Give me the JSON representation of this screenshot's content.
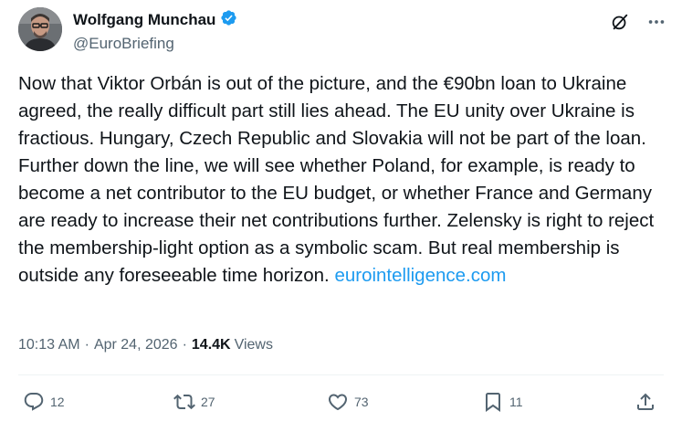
{
  "author": {
    "display_name": "Wolfgang Munchau",
    "handle": "@EuroBriefing",
    "verified": true,
    "verified_color": "#1d9bf0"
  },
  "top_icons": [
    "grok-icon",
    "more-icon"
  ],
  "tweet": {
    "text": "Now that Viktor Orbán is out of the picture, and the €90bn loan to Ukraine agreed, the really difficult part still lies ahead. The EU unity over Ukraine is fractious. Hungary, Czech Republic and Slovakia will not be part of the loan. Further down the line, we will see whether Poland, for example, is ready to become a net contributor to the EU budget, or whether France and Germany are ready to increase their net contributions further. Zelensky is right to reject the membership-light option as a symbolic scam. But real membership is outside any foreseeable time horizon. ",
    "link_text": "eurointelligence.com",
    "link_color": "#1d9bf0"
  },
  "meta": {
    "time": "10:13 AM",
    "separator": "·",
    "date": "Apr 24, 2026",
    "views_count": "14.4K",
    "views_label": "Views"
  },
  "actions": {
    "replies": "12",
    "reposts": "27",
    "likes": "73",
    "bookmarks": "11"
  },
  "colors": {
    "text": "#0f1419",
    "secondary": "#536471",
    "accent": "#1d9bf0",
    "divider": "#eff3f4"
  }
}
